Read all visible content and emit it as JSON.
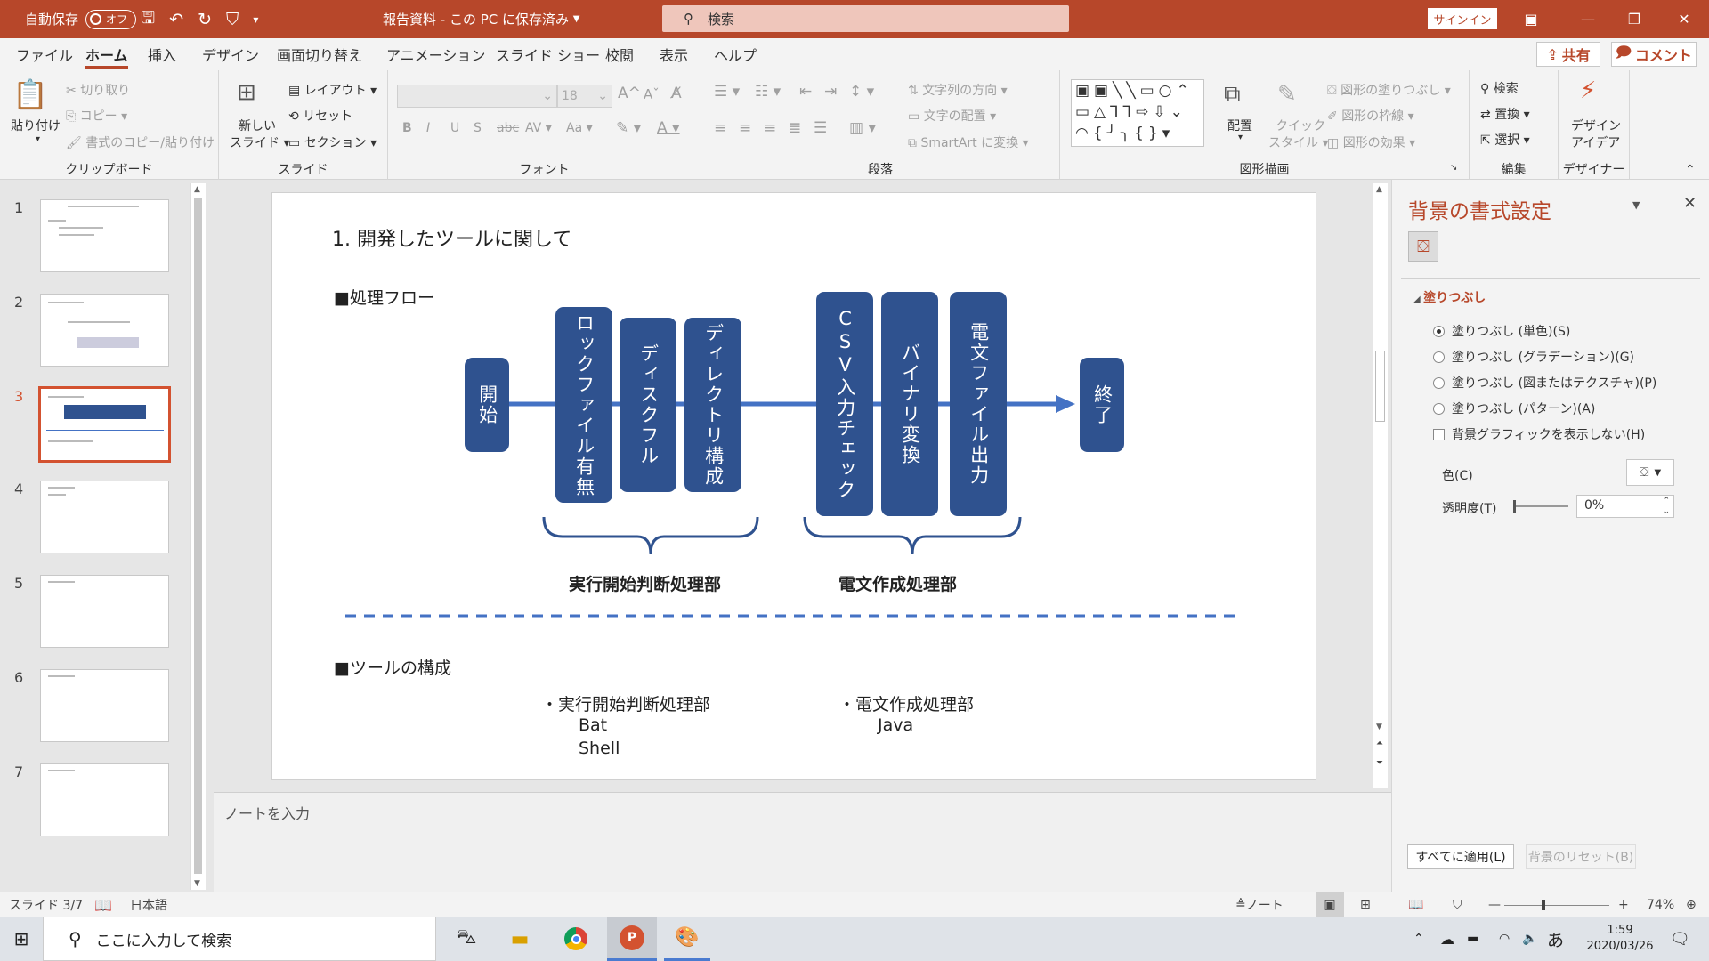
{
  "title_bar": {
    "autosave_label": "自動保存",
    "toggle_label": "オフ",
    "doc_title": "報告資料 - この PC に保存済み",
    "search_placeholder": "検索",
    "signin": "サインイン"
  },
  "menu": {
    "tabs": [
      "ファイル",
      "ホーム",
      "挿入",
      "デザイン",
      "画面切り替え",
      "アニメーション",
      "スライド ショー",
      "校閲",
      "表示",
      "ヘルプ"
    ],
    "share": "共有",
    "comment": "コメント"
  },
  "ribbon": {
    "clipboard": {
      "label": "クリップボード",
      "paste": "貼り付け",
      "cut": "切り取り",
      "copy": "コピー",
      "format_copy": "書式のコピー/貼り付け"
    },
    "slides": {
      "label": "スライド",
      "new_slide_1": "新しい",
      "new_slide_2": "スライド",
      "layout": "レイアウト",
      "reset": "リセット",
      "section": "セクション"
    },
    "font": {
      "label": "フォント",
      "size": "18",
      "styles": [
        "B",
        "I",
        "U",
        "S",
        "abc",
        "AV",
        "Aa"
      ]
    },
    "paragraph": {
      "label": "段落",
      "text_direction": "文字列の方向",
      "align_text": "文字の配置",
      "smartart": "SmartArt に変換"
    },
    "drawing": {
      "label": "図形描画",
      "arrange": "配置",
      "quick_style_1": "クイック",
      "quick_style_2": "スタイル",
      "fill": "図形の塗りつぶし",
      "outline": "図形の枠線",
      "effect": "図形の効果"
    },
    "editing": {
      "label": "編集",
      "find": "検索",
      "replace": "置換",
      "select": "選択"
    },
    "designer": {
      "label": "デザイナー",
      "design_1": "デザイン",
      "design_2": "アイデア"
    }
  },
  "thumbnails": [
    "1",
    "2",
    "3",
    "4",
    "5",
    "6",
    "7"
  ],
  "slide": {
    "heading": "1. 開発したツールに関して",
    "section1": "■処理フロー",
    "start": "開始",
    "end": "終了",
    "boxes": [
      "ロックファイル有無",
      "ディスクフル",
      "ディレクトリ構成",
      "CSV入力チェック",
      "バイナリ変換",
      "電文ファイル出力"
    ],
    "group1": "実行開始判断処理部",
    "group2": "電文作成処理部",
    "section2": "■ツールの構成",
    "tool1_title": "・実行開始判断処理部",
    "tool1_items": [
      "Bat",
      "Shell"
    ],
    "tool2_title": "・電文作成処理部",
    "tool2_items": [
      "Java"
    ]
  },
  "notes_placeholder": "ノートを入力",
  "format_pane": {
    "title": "背景の書式設定",
    "section": "塗りつぶし",
    "options": [
      "塗りつぶし (単色)(S)",
      "塗りつぶし (グラデーション)(G)",
      "塗りつぶし (図またはテクスチャ)(P)",
      "塗りつぶし (パターン)(A)"
    ],
    "hide_bg": "背景グラフィックを表示しない(H)",
    "color_label": "色(C)",
    "transparency_label": "透明度(T)",
    "transparency_value": "0%",
    "apply_all": "すべてに適用(L)",
    "reset_bg": "背景のリセット(B)"
  },
  "status": {
    "slide_num": "スライド 3/7",
    "language": "日本語",
    "notes": "ノート",
    "zoom": "74%"
  },
  "taskbar": {
    "search_placeholder": "ここに入力して検索",
    "time": "1:59",
    "date": "2020/03/26",
    "ime": "あ"
  },
  "colors": {
    "accent": "#b7472a",
    "box": "#2f528f",
    "arrow": "#4472c4"
  }
}
